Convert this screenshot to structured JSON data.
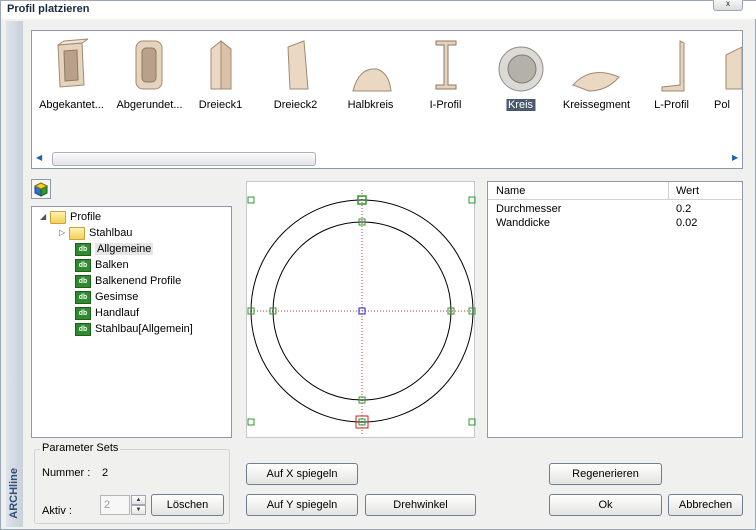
{
  "window": {
    "title": "Profil platzieren",
    "close_glyph": "x",
    "brand": "ARCHline"
  },
  "gallery": {
    "items": [
      {
        "label": "Abgekantet...",
        "icon": "rectangular-tube-icon",
        "selected": false
      },
      {
        "label": "Abgerundet...",
        "icon": "rounded-tube-icon",
        "selected": false
      },
      {
        "label": "Dreieck1",
        "icon": "triangle1-profile-icon",
        "selected": false
      },
      {
        "label": "Dreieck2",
        "icon": "triangle2-profile-icon",
        "selected": false
      },
      {
        "label": "Halbkreis",
        "icon": "half-circle-profile-icon",
        "selected": false
      },
      {
        "label": "I-Profil",
        "icon": "i-beam-profile-icon",
        "selected": false
      },
      {
        "label": "Kreis",
        "icon": "circle-tube-icon",
        "selected": true
      },
      {
        "label": "Kreissegment",
        "icon": "circle-segment-profile-icon",
        "selected": false
      },
      {
        "label": "L-Profil",
        "icon": "l-profile-icon",
        "selected": false
      },
      {
        "label": "Pol",
        "icon": "polygon-profile-icon",
        "selected": false
      }
    ],
    "scroll_left": "◀",
    "scroll_right": "▶"
  },
  "tree": {
    "root": "Profile",
    "children": [
      {
        "label": "Stahlbau",
        "type": "folder"
      },
      {
        "label": "Allgemeine",
        "type": "db",
        "selected": true
      },
      {
        "label": "Balken",
        "type": "db"
      },
      {
        "label": "Balkenend Profile",
        "type": "db"
      },
      {
        "label": "Gesimse",
        "type": "db"
      },
      {
        "label": "Handlauf",
        "type": "db"
      },
      {
        "label": "Stahlbau[Allgemein]",
        "type": "db"
      }
    ],
    "db_badge": "db"
  },
  "properties": {
    "col_name": "Name",
    "col_value": "Wert",
    "rows": [
      {
        "name": "Durchmesser",
        "value": "0.2"
      },
      {
        "name": "Wanddicke",
        "value": "0.02"
      }
    ]
  },
  "parameter_sets": {
    "title": "Parameter Sets",
    "nummer_label": "Nummer :",
    "nummer_value": "2",
    "aktiv_label": "Aktiv :",
    "aktiv_value": "2",
    "delete_label": "Löschen"
  },
  "buttons": {
    "mirror_x": "Auf X spiegeln",
    "mirror_y": "Auf Y spiegeln",
    "rotation": "Drehwinkel",
    "regenerate": "Regenerieren",
    "ok": "Ok",
    "cancel": "Abbrechen"
  },
  "colors": {
    "handle_green": "#2a9a2a",
    "handle_red": "#d02020",
    "center_blue": "#2020c0",
    "axis_red": "#e03030"
  }
}
